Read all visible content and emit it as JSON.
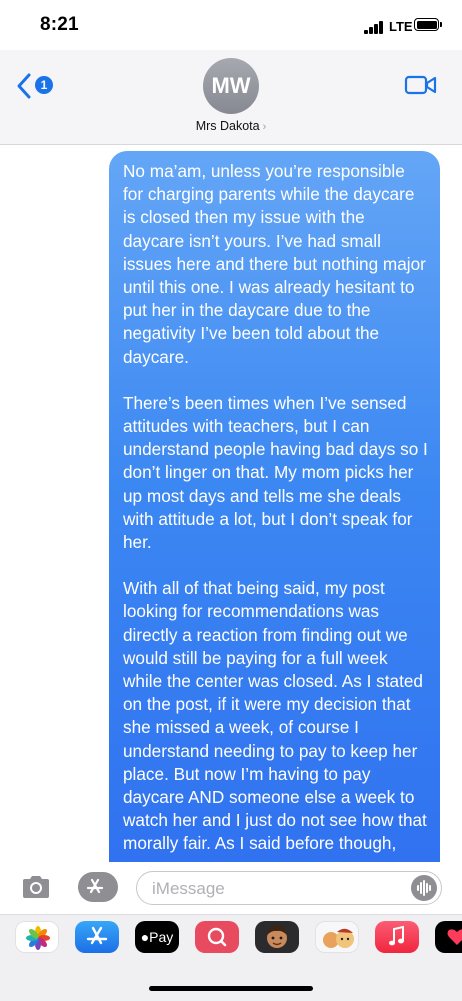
{
  "status_bar": {
    "time": "8:21",
    "network": "LTE"
  },
  "header": {
    "back_badge": "1",
    "avatar_initials": "MW",
    "contact_name": "Mrs Dakota",
    "icons": [
      "back-chevron-icon",
      "video-camera-icon"
    ]
  },
  "conversation": {
    "message_paragraphs": [
      "No ma’am, unless you’re responsible for charging parents while the daycare is closed then my issue with the daycare isn’t yours. I’ve had small issues here and there but nothing major until this one. I was already hesitant to put her in the daycare due to the negativity I’ve been told about the daycare.",
      "There’s been times when I’ve sensed attitudes with teachers, but I can understand people having bad days so I don’t linger on that. My mom picks her up most days and tells me she deals with attitude a lot, but I don’t speak for her.",
      "With all of that being said, my post looking for recommendations was directly a reaction from finding out we would still be paying for a full week while the center was closed. As I stated on the post, if it were my decision that she missed a week, of course I understand needing to pay to keep her place. But now I’m having to pay daycare AND someone else a week to watch her and I just do not see how that morally fair. As I said before though,"
    ],
    "bubble_color": "#3b87f2"
  },
  "input_bar": {
    "placeholder": "iMessage",
    "icons": [
      "camera-icon",
      "app-store-icon",
      "audio-waveform-icon"
    ]
  },
  "app_drawer": {
    "apple_pay_label": "Pay",
    "apps": [
      "photos-app-icon",
      "app-store-app-icon",
      "apple-pay-app-icon",
      "search-images-app-icon",
      "memoji-app-icon",
      "animoji-app-icon",
      "music-app-icon",
      "digital-touch-app-icon"
    ]
  }
}
